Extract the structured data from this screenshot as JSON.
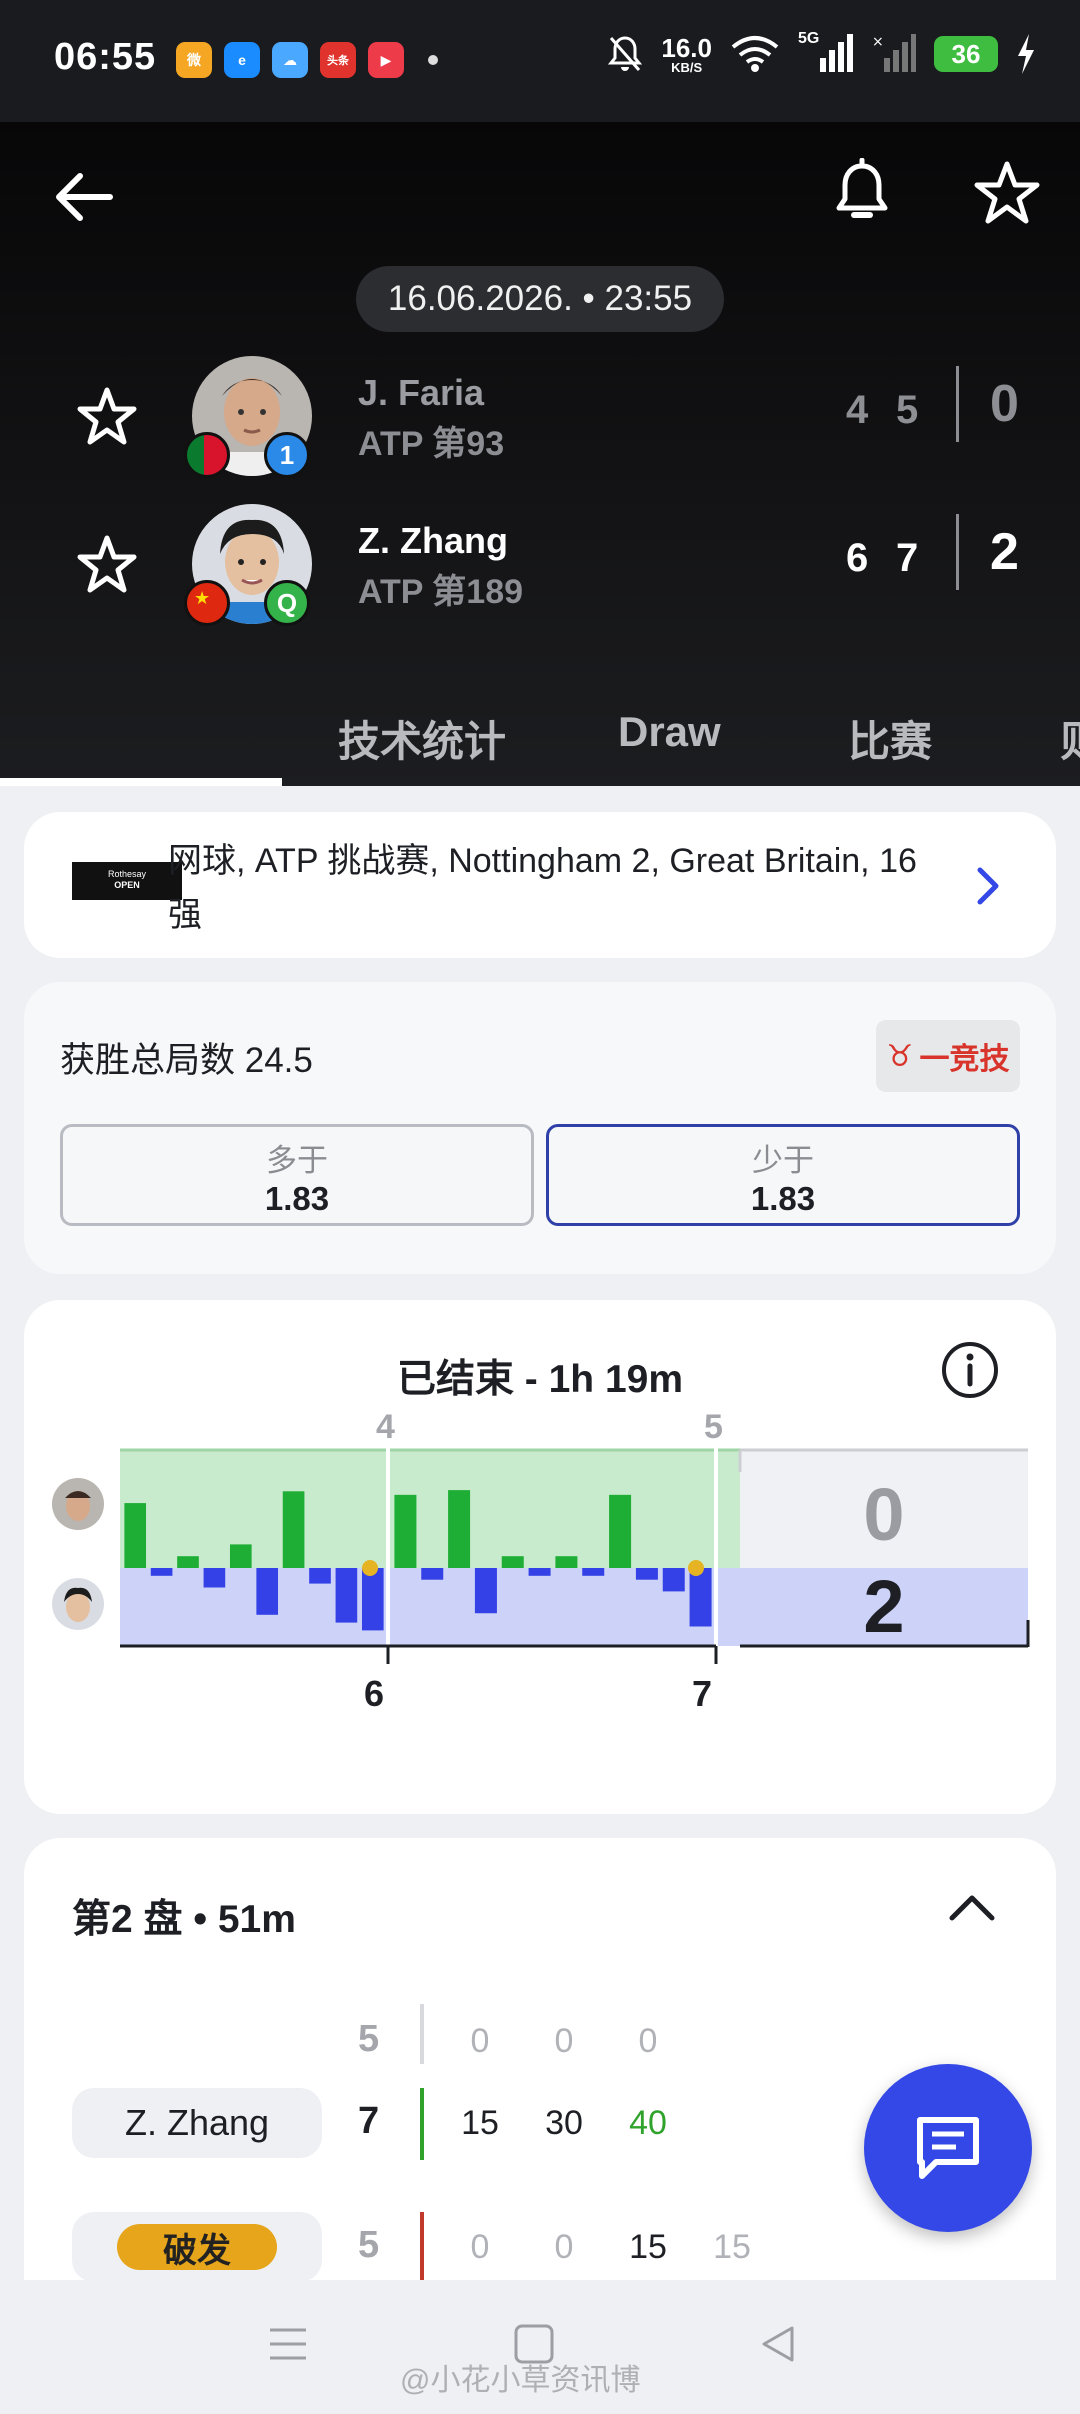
{
  "status_bar": {
    "time": "06:55",
    "net_speed": "16.0",
    "net_unit": "KB/S",
    "signal_label": "5G",
    "battery": "36",
    "app_icons": [
      "weibo-icon",
      "ele-icon",
      "weather-icon",
      "toutiao-icon",
      "video-icon"
    ]
  },
  "match": {
    "datetime": "16.06.2026. • 23:55",
    "players": [
      {
        "name": "J. Faria",
        "rank": "ATP 第93",
        "seed": "1",
        "flag": "portugal-flag",
        "sets": [
          "4",
          "5"
        ],
        "sets_won": "0"
      },
      {
        "name": "Z. Zhang",
        "rank": "ATP 第189",
        "seed": "Q",
        "flag": "china-flag",
        "sets": [
          "6",
          "7"
        ],
        "sets_won": "2"
      }
    ]
  },
  "tabs": [
    "技术统计",
    "Draw",
    "比赛",
    "则"
  ],
  "league": {
    "logo_text_top": "Rothesay",
    "logo_text_bottom": "OPEN",
    "text": "网球, ATP 挑战赛, Nottingham 2, Great Britain, 16强"
  },
  "odds": {
    "title": "获胜总局数 24.5",
    "bookmaker": "一竞技",
    "over_label": "多于",
    "over_value": "1.83",
    "under_label": "少于",
    "under_value": "1.83"
  },
  "momentum": {
    "title": "已结束 - 1h 19m",
    "top_set_labels": [
      "4",
      "5"
    ],
    "bottom_set_labels": [
      "6",
      "7"
    ],
    "score_top": "0",
    "score_bottom": "2",
    "set1_bars": [
      0.55,
      -0.1,
      0.1,
      -0.25,
      0.2,
      -0.6,
      0.65,
      -0.2,
      -0.7,
      -0.8
    ],
    "set2_bars": [
      0.62,
      -0.15,
      0.66,
      -0.58,
      0.1,
      -0.1,
      0.1,
      -0.1,
      0.62,
      -0.15,
      -0.3,
      -0.75
    ]
  },
  "set_detail": {
    "title": "第2 盘 • 51m",
    "rows": [
      {
        "label": "",
        "game": "5",
        "points": [
          "0",
          "0",
          "0"
        ]
      },
      {
        "label": "Z. Zhang",
        "game": "7",
        "points": [
          "15",
          "30",
          "40"
        ]
      },
      {
        "label": "破发",
        "game": "5",
        "points": [
          "0",
          "0",
          "15",
          "15"
        ]
      }
    ]
  },
  "watermark": "@小花小草资讯博",
  "colors": {
    "accent": "#3348e6",
    "faria_green": "#1fae35",
    "zhang_blue": "#3341e6",
    "break": "#e6a51a"
  }
}
